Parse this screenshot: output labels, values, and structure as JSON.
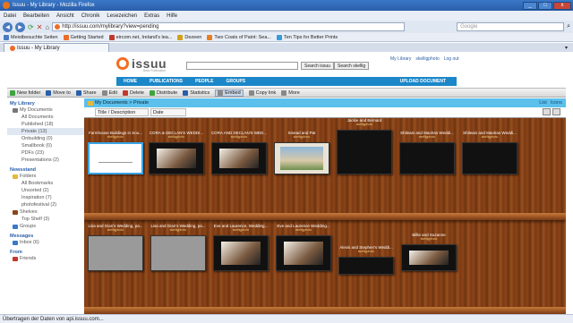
{
  "window": {
    "title": "Issuu - My Library - Mozilla Firefox",
    "min": "_",
    "max": "□",
    "close": "x"
  },
  "menu": [
    "Datei",
    "Bearbeiten",
    "Ansicht",
    "Chronik",
    "Lesezeichen",
    "Extras",
    "Hilfe"
  ],
  "nav": {
    "url": "http://issuu.com/mylibrary?view=pending",
    "search_placeholder": "Google"
  },
  "bookmarks": [
    {
      "label": "Meistbesuchte Seiten",
      "color": "#4a7bc0"
    },
    {
      "label": "Getting Started",
      "color": "#ec6d2a"
    },
    {
      "label": "eircom.net, Ireland's lea...",
      "color": "#c0392b"
    },
    {
      "label": "Dezeen",
      "color": "#d4a017"
    },
    {
      "label": "Two Coats of Paint: Sea...",
      "color": "#e67e22"
    },
    {
      "label": "Ten Tips for Better Prints",
      "color": "#3a9bd9"
    }
  ],
  "tab": {
    "label": "Issuu - My Library"
  },
  "site": {
    "logo": "issuu",
    "tagline": "Beta Publication",
    "search_button": "Search issuu",
    "search_mine_button": "Search skellig",
    "top_links": [
      "My Library",
      "skelligphoto",
      "Log out"
    ],
    "nav": [
      "HOME",
      "PUBLICATIONS",
      "PEOPLE",
      "GROUPS"
    ],
    "upload": "UPLOAD DOCUMENT"
  },
  "actions": [
    {
      "label": "New folder",
      "color": "#3fa33f"
    },
    {
      "label": "Move to",
      "color": "#2a5ea8"
    },
    {
      "label": "Share",
      "color": "#2a5ea8"
    },
    {
      "label": "Edit",
      "color": "#888"
    },
    {
      "label": "Delete",
      "color": "#c0392b"
    },
    {
      "label": "Distribute",
      "color": "#3fa33f"
    },
    {
      "label": "Statistics",
      "color": "#2a5ea8"
    },
    {
      "label": "Embed",
      "color": "#888"
    },
    {
      "label": "Copy link",
      "color": "#888"
    },
    {
      "label": "More",
      "color": "#888"
    }
  ],
  "sidebar": {
    "library": "My Library",
    "my_documents": "My Documents",
    "doc_items": [
      "All Documents",
      "Published (18)",
      "Private (13)",
      "Onbuilding (0)",
      "Smallbook (0)",
      "PDFs (23)",
      "Presentations (2)"
    ],
    "newsstand": "Newsstand",
    "folders": "Folders",
    "folder_items": [
      "All Bookmarks",
      "Unsorted (2)",
      "Inspiration (7)",
      "photofestival (2)"
    ],
    "shelves": "Shelves",
    "shelf_items": [
      "Top Shelf (3)"
    ],
    "groups": "Groups",
    "messages": "Messages",
    "inbox": "Inbox (6)",
    "from": "From",
    "friends": "Friends"
  },
  "breadcrumb": {
    "path": "My Documents > Private",
    "right": [
      "List",
      "Icons"
    ]
  },
  "columns": {
    "title": "Title / Description",
    "date": "Date"
  },
  "documents": [
    {
      "title": "Farmhouse Buildings in Sou...",
      "user": "skelligphoto"
    },
    {
      "title": "CORA & DECLAN'S WEDDI...",
      "user": "skelligphoto"
    },
    {
      "title": "CORA AND DECLAN'S WED...",
      "user": "skelligphoto"
    },
    {
      "title": "Sinead and Pat",
      "user": "skelligphoto"
    },
    {
      "title": "Jackie and Bernard",
      "user": "skelligphoto"
    },
    {
      "title": "Shileain and Maolras Weddi...",
      "user": "skelligphoto"
    },
    {
      "title": "Shileain and Maolras Weddi...",
      "user": "skelligphoto"
    },
    {
      "title": "Lisa and Gian's Wedding, pa...",
      "user": "skelligphoto"
    },
    {
      "title": "Lisa and Gian's Wedding, pa...",
      "user": "skelligphoto"
    },
    {
      "title": "Eve and Laurence, Wedding...",
      "user": "skelligphoto"
    },
    {
      "title": "Eve and Laurence Wedding...",
      "user": "skelligphoto"
    },
    {
      "title": "Alexis and Stephen's Weddi...",
      "user": "skelligphoto"
    },
    {
      "title": "Billie and Suzanne",
      "user": "skelligphoto"
    }
  ],
  "status": "Übertragen der Daten von api.issuu.com..."
}
